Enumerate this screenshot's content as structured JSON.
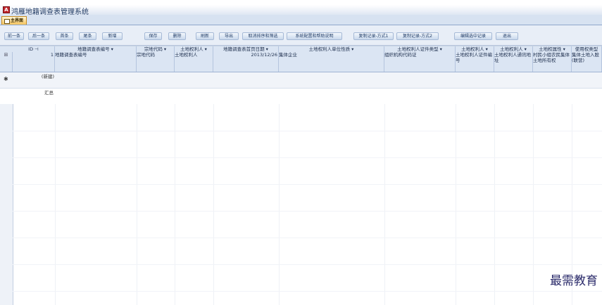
{
  "window": {
    "app_title": "鸿雁地籍调查表管理系统",
    "app_icon_letter": "A",
    "tab_label": "主界面"
  },
  "toolbar": {
    "buttons": [
      "前一条",
      "后一条",
      "首条",
      "尾条",
      "新增",
      "保存",
      "删除",
      "刷新",
      "导出",
      "取消排序和筛选",
      "系统配置和帮助说明",
      "复制记录-方式1",
      "复制记录-方式2",
      "编辑选中记录",
      "退出"
    ]
  },
  "grid": {
    "headers": [
      "ID",
      "地籍调查表编号",
      "宗地代码",
      "土地权利人",
      "地籍调查表首页日期",
      "土地权利人单位性质",
      "土地权利人证件类型",
      "土地权利人",
      "土地权利人",
      "土地权属性",
      "使用权类型"
    ],
    "row1": {
      "id": "1",
      "cells": [
        "地籍调查表编号",
        "宗地代码",
        "土地权利人",
        "2013/12/26",
        "集体企业",
        "组织机构代码证",
        "土地权利人证件编号",
        "土地权利人通讯地址",
        "村民小组农民集体土地所有权",
        "集体土地入股(联营)"
      ]
    },
    "new_row_label": "(新建)",
    "total_row_label": "汇总"
  },
  "watermark": "最需教育"
}
